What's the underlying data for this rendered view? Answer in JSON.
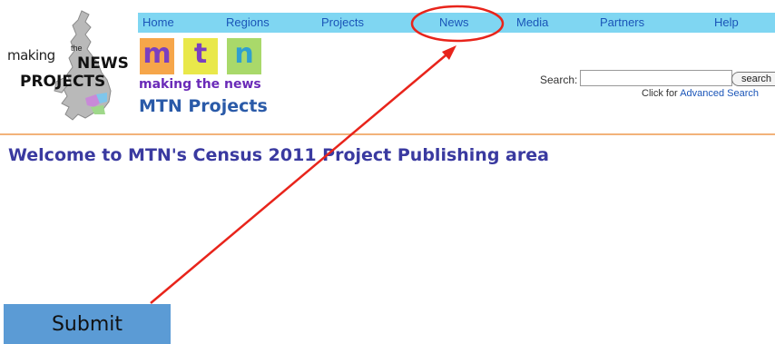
{
  "nav": {
    "items": [
      {
        "label": "Home"
      },
      {
        "label": "Regions"
      },
      {
        "label": "Projects"
      },
      {
        "label": "News"
      },
      {
        "label": "Media"
      },
      {
        "label": "Partners"
      },
      {
        "label": "Help"
      }
    ]
  },
  "logo": {
    "making": "making",
    "the": "the",
    "news": "NEWS",
    "projects": "PROJECTS",
    "letters": [
      "m",
      "t",
      "n"
    ],
    "letter_colors": [
      "#f0932a",
      "#7a3fc0",
      "#2f9fcf"
    ],
    "box_colors": [
      "#f6a64a",
      "#e9e84a",
      "#a9d96a"
    ],
    "tagline": "making the news"
  },
  "site": {
    "title": "MTN Projects"
  },
  "search": {
    "label": "Search:",
    "value": "",
    "button_label": "search",
    "advanced_prefix": "Click for ",
    "advanced_link": "Advanced Search"
  },
  "main": {
    "welcome": "Welcome to MTN's Census 2011 Project Publishing area"
  },
  "annotation": {
    "submit_label": "Submit",
    "highlight_color": "#e8241b",
    "button_color": "#5b9bd5"
  }
}
